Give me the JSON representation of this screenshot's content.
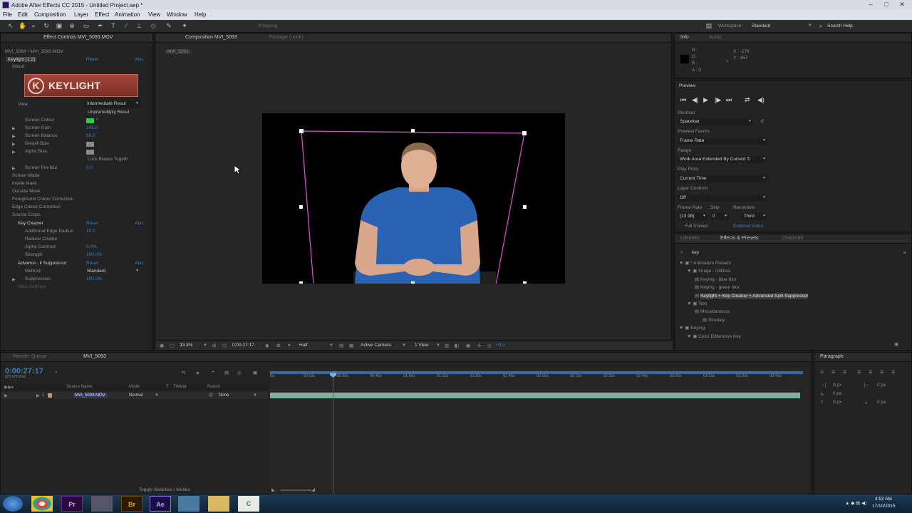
{
  "window": {
    "title": "Adobe After Effects CC 2015 - Untitled Project.aep *",
    "minimize": "–",
    "maximize": "□",
    "close": "✕"
  },
  "menu": [
    "File",
    "Edit",
    "Composition",
    "Layer",
    "Effect",
    "Animation",
    "View",
    "Window",
    "Help"
  ],
  "toolbar": {
    "snapping": "Snapping",
    "workspace_label": "Workspace:",
    "workspace_value": "Standard",
    "search_help": "Search Help"
  },
  "effect_controls": {
    "tab": "Effect Controls MVI_5093.MOV",
    "layer_path": "MVI_5093 • MVI_5093.MOV",
    "keylight": {
      "name": "Keylight (1.2)",
      "reset": "Reset",
      "about_short": "Abo",
      "about": "About",
      "logo": "KEYLIGHT",
      "view_label": "View",
      "view_value": "Intermediate Resul",
      "unpremultiply": "Unpremultiply Resul",
      "screen_colour": "Screen Colour",
      "screen_gain": "Screen Gain",
      "screen_gain_value": "145.0",
      "screen_balance": "Screen Balance",
      "screen_balance_value": "50.0",
      "despill_bias": "Despill Bias",
      "alpha_bias": "Alpha Bias",
      "lock_biases": "Lock Biases Togeth",
      "screen_preblur": "Screen Pre-blur",
      "screen_preblur_value": "0.0",
      "groups": [
        "Screen Matte",
        "Inside Mask",
        "Outside Mask",
        "Foreground Colour Correction",
        "Edge Colour Correction",
        "Source Crops"
      ]
    },
    "key_cleaner": {
      "name": "Key Cleaner",
      "reset": "Reset",
      "about": "Abo",
      "additional_edge_radius": "Additional Edge Radius",
      "additional_edge_radius_value": "10.0",
      "reduce_chatter": "Reduce Chatter",
      "alpha_contrast": "Alpha Contrast",
      "alpha_contrast_value": "0.0%",
      "strength": "Strength",
      "strength_value": "100.0%"
    },
    "spill": {
      "name": "Advance...ll Suppressor",
      "reset": "Reset",
      "about": "Abo",
      "method": "Method",
      "method_value": "Standard",
      "suppression": "Suppression",
      "suppression_value": "100.0%",
      "ultra": "Ultra Settings"
    },
    "colors": {
      "screen_colour": "#2ecc40"
    }
  },
  "composition": {
    "tab": "Composition MVI_5093",
    "footage_tab": "Footage (none)",
    "breadcrumb": "MVI_5093",
    "zoom": "33.3%",
    "timecode": "0:00:27:17",
    "resolution": "Half",
    "camera": "Active Camera",
    "views": "1 View",
    "exposure": "+0.0"
  },
  "info": {
    "tab": "Info",
    "audio_tab": "Audio",
    "r": "R :",
    "g": "G :",
    "b": "B :",
    "a": "A : 0",
    "x": "X : -178",
    "y": "Y : 357"
  },
  "preview": {
    "title": "Preview",
    "shortcut_label": "Shortcut",
    "shortcut_value": "Spacebar",
    "preview_favors_label": "Preview Favors",
    "preview_favors_value": "Frame Rate",
    "range_label": "Range",
    "range_value": "Work Area Extended By Current Ti",
    "play_from_label": "Play From",
    "play_from_value": "Current Time",
    "layer_controls_label": "Layer Controls",
    "layer_controls_value": "Off",
    "frame_rate_label": "Frame Rate",
    "skip_label": "Skip",
    "resolution_label": "Resolution",
    "frame_rate_value": "(23.98)",
    "skip_value": "0",
    "resolution_value": "Third",
    "full_screen": "Full Screen",
    "external_video": "External Video"
  },
  "effects_presets": {
    "tabs": [
      "Libraries",
      "Effects & Presets",
      "Character"
    ],
    "search": "key",
    "tree": [
      {
        "label": "* Animation Presets",
        "level": 0
      },
      {
        "label": "Image - Utilities",
        "level": 1
      },
      {
        "label": "Keying - blue blur",
        "level": 2
      },
      {
        "label": "Keying - green blur",
        "level": 2
      },
      {
        "label": "Keylight + Key Cleaner + Advanced Spill Suppressor",
        "level": 2,
        "selected": true
      },
      {
        "label": "Text",
        "level": 1
      },
      {
        "label": "Miscellaneous",
        "level": 2
      },
      {
        "label": "Smokey",
        "level": 3
      },
      {
        "label": "Keying",
        "level": 0
      },
      {
        "label": "Color Difference Key",
        "level": 1
      }
    ]
  },
  "timeline": {
    "render_queue_tab": "Render Queue",
    "comp_tab": "MVI_5093",
    "timecode": "0:00:27:17",
    "fps": "(23.976 fps)",
    "columns": {
      "source_name": "Source Name",
      "mode": "Mode",
      "t": "T",
      "trkmat": "TrkMat",
      "parent": "Parent"
    },
    "layer": {
      "index": "1",
      "name": "MVI_5093.MOV",
      "mode": "Normal",
      "parent": "None"
    },
    "ruler": [
      "0s",
      "00:15s",
      "00:30s",
      "00:45s",
      "01:00s",
      "01:15s",
      "01:30s",
      "01:45s",
      "02:00s",
      "02:15s",
      "02:30s",
      "02:45s",
      "03:00s",
      "03:15s",
      "03:30s",
      "03:45s"
    ],
    "toggle": "Toggle Switches / Modes"
  },
  "paragraph": {
    "tab": "Paragraph",
    "values": [
      "0 px",
      "0 px",
      "0 px",
      "0 px",
      "0 px"
    ]
  },
  "taskbar": {
    "apps": [
      "Pr",
      "",
      "Br",
      "Ae",
      "",
      ""
    ],
    "time": "4:52 AM",
    "date": "17/10/2015"
  }
}
